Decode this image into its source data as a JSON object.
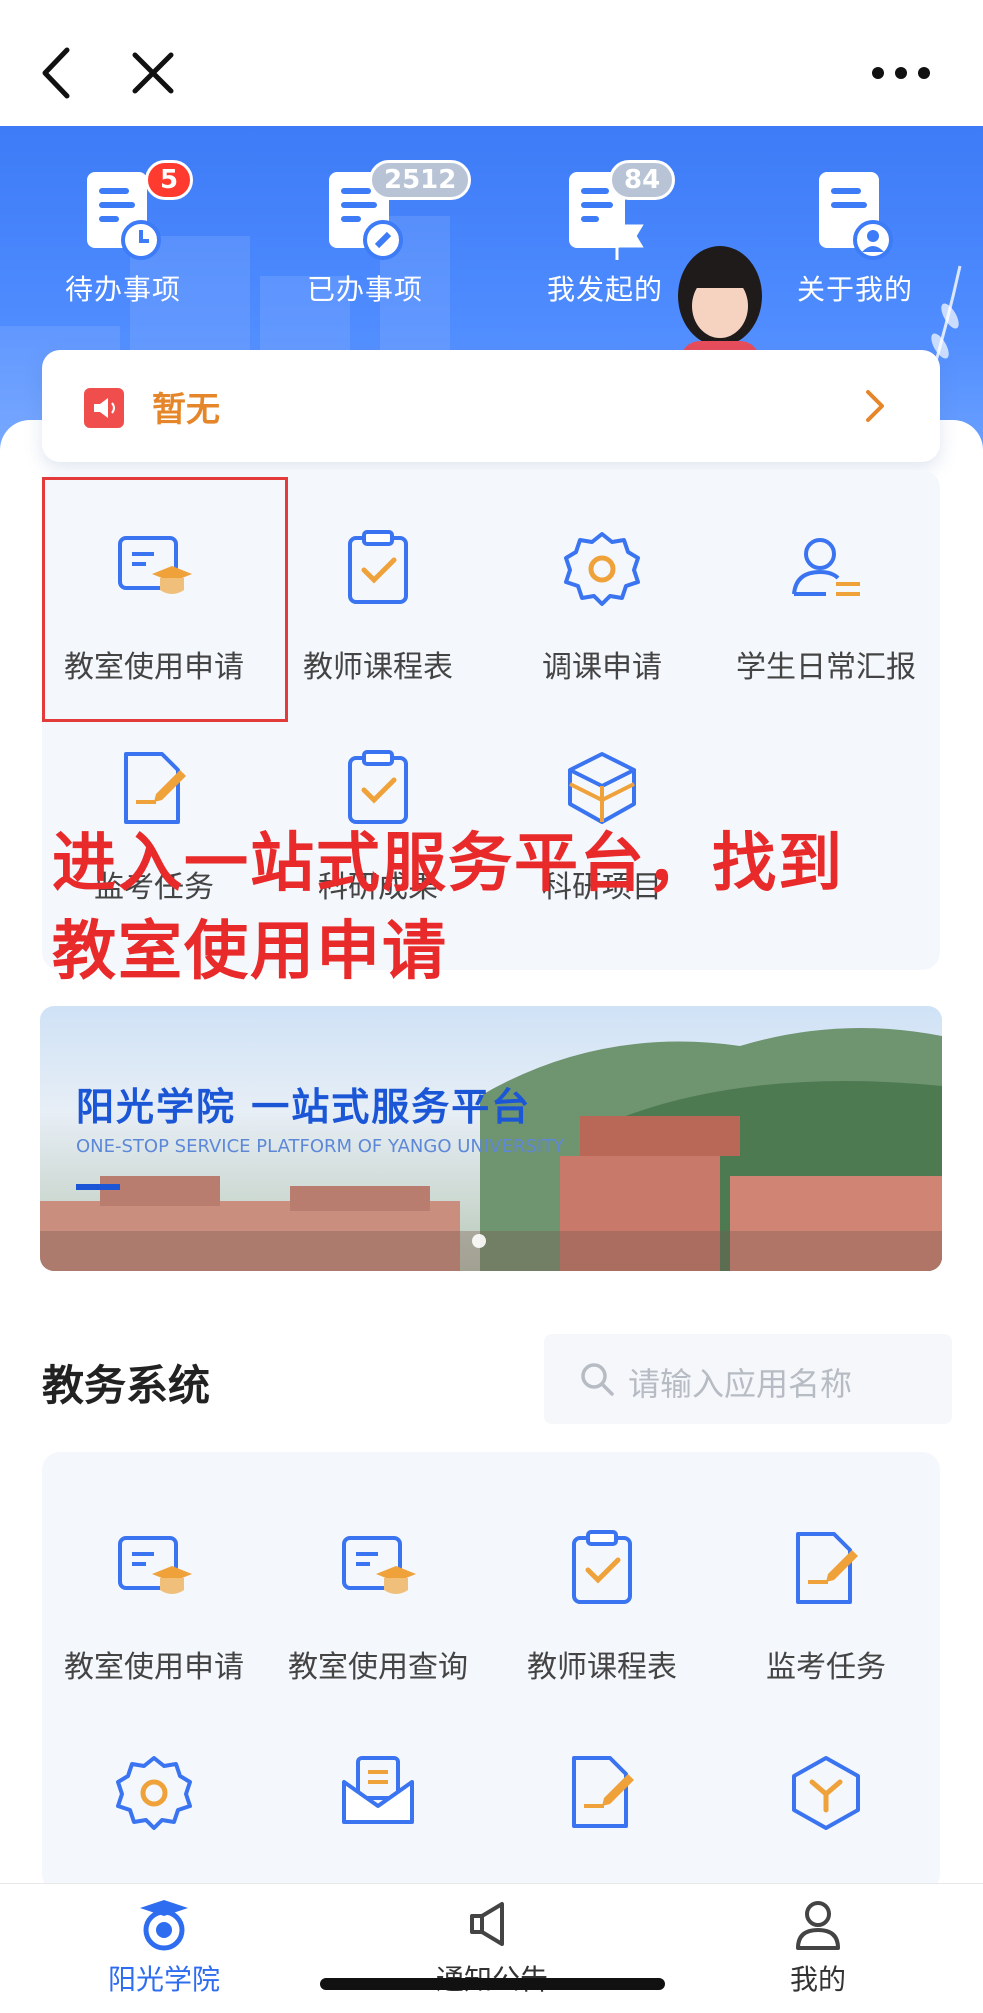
{
  "nav": {
    "back_icon": "chevron-left-icon",
    "close_icon": "close-icon",
    "more_icon": "more-horizontal-icon"
  },
  "quick_links": [
    {
      "label": "待办事项",
      "badge": "5",
      "icon": "todo-clock-icon"
    },
    {
      "label": "已办事项",
      "badge": "2512",
      "icon": "done-pin-icon"
    },
    {
      "label": "我发起的",
      "badge": "84",
      "icon": "flag-doc-icon"
    },
    {
      "label": "关于我的",
      "badge": "",
      "icon": "user-doc-icon"
    }
  ],
  "notice": {
    "text": "暂无"
  },
  "featured_apps": [
    {
      "label": "教室使用申请",
      "icon": "classroom-apply-icon"
    },
    {
      "label": "教师课程表",
      "icon": "clipboard-check-icon"
    },
    {
      "label": "调课申请",
      "icon": "gear-icon"
    },
    {
      "label": "学生日常汇报",
      "icon": "user-report-icon"
    },
    {
      "label": "监考任务",
      "icon": "doc-edit-icon"
    },
    {
      "label": "科研成果",
      "icon": "clipboard-check-icon"
    },
    {
      "label": "科研项目",
      "icon": "cube-icon"
    }
  ],
  "annotation": {
    "line1": "进入一站式服务平台，找到",
    "line2": "教室使用申请"
  },
  "banner": {
    "title": "阳光学院 一站式服务平台",
    "subtitle": "ONE-STOP SERVICE PLATFORM OF YANGO UNIVERSITY"
  },
  "section": {
    "title": "教务系统",
    "search_placeholder": "请输入应用名称"
  },
  "system_apps": [
    {
      "label": "教室使用申请",
      "icon": "classroom-apply-icon"
    },
    {
      "label": "教室使用查询",
      "icon": "classroom-query-icon"
    },
    {
      "label": "教师课程表",
      "icon": "clipboard-check-icon"
    },
    {
      "label": "监考任务",
      "icon": "doc-edit-icon"
    },
    {
      "label": "",
      "icon": "gear-icon"
    },
    {
      "label": "",
      "icon": "mail-icon"
    },
    {
      "label": "",
      "icon": "doc-edit-icon"
    },
    {
      "label": "",
      "icon": "cube-icon"
    }
  ],
  "tabs": [
    {
      "label": "阳光学院",
      "icon": "college-logo-icon",
      "active": true
    },
    {
      "label": "通知公告",
      "icon": "megaphone-icon",
      "active": false
    },
    {
      "label": "我的",
      "icon": "person-icon",
      "active": false
    }
  ],
  "colors": {
    "brand_blue": "#3d7bf7",
    "accent_orange": "#e6862a",
    "annotation_red": "#e82a2a",
    "icon_blue": "#3b74f0",
    "icon_orange": "#f0a23a"
  }
}
